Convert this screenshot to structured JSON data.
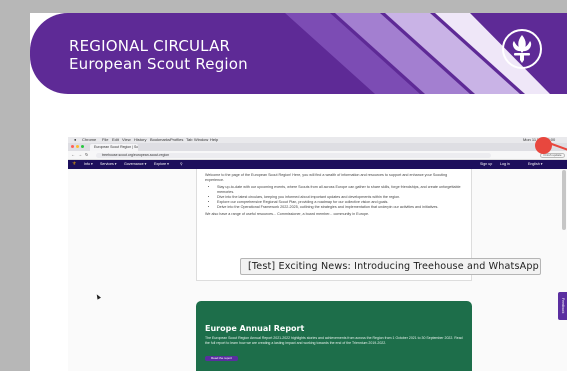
{
  "banner": {
    "line1": "REGIONAL CIRCULAR",
    "line2": "European Scout Region",
    "emblem_icon": "scout-fleur-de-lis-icon",
    "color": "#5e2a96"
  },
  "browser": {
    "menubar_items": [
      "Chrome",
      "File",
      "Edit",
      "View",
      "History",
      "Bookmarks",
      "Profiles",
      "Tab",
      "Window",
      "Help"
    ],
    "menubar_right": "Mon 11 Mar 13:00",
    "tab_title": "European Scout Region | Scou...",
    "url": "treehouse.scout.org/european-scout-region",
    "update_label": "Finish update"
  },
  "site_nav": {
    "items": [
      "Info ▾",
      "Services ▾",
      "Governance ▾",
      "Explore ▾"
    ],
    "signup": "Sign up",
    "login": "Log in",
    "language": "English ▾"
  },
  "content": {
    "intro": "Welcome to the page of the European Scout Region! Here, you will find a wealth of information and resources to support and enhance your Scouting experience.",
    "bullets": [
      "Stay up-to-date with our upcoming events, where Scouts from all across Europe can gather to share skills, forge friendships, and create unforgettable memories.",
      "Dive into the latest circulars, keeping you informed about important updates and developments within the region.",
      "Explore our comprehensive Regional Scout Plan, providing a roadmap for our collective vision and goals.",
      "Delve into the Operational Framework 2022-2025, outlining the strategies and implementation that underpin our activities and initiatives."
    ],
    "after": "We also have a range of useful resources... Commissioner, a board member... community in Europe."
  },
  "annual_report": {
    "title": "Europe Annual Report",
    "body": "The European Scout Region Annual Report 2021-2022 highlights stories and achievements from across the Region from 1 October 2021 to 30 September 2022. Read the full report to learn how we are creating a lasting impact and working towards the end of the Triennium 2019-2022.",
    "button": "Read the report",
    "color": "#1d6e4a"
  },
  "tooltip": "[Test] Exciting News: Introducing Treehouse and WhatsApp",
  "feedback_label": "Feedback",
  "accent_red": "#e8473e"
}
